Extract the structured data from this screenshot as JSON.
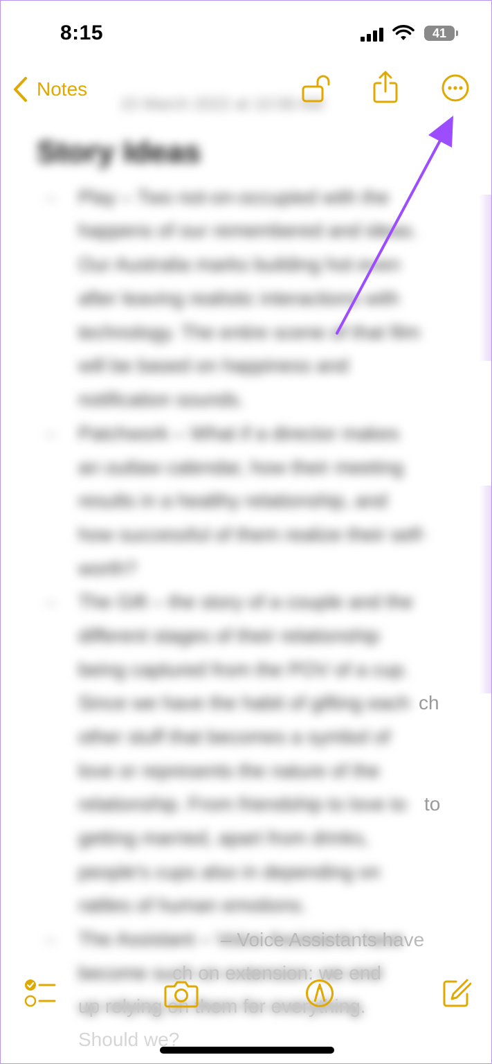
{
  "status_bar": {
    "time": "8:15",
    "battery": "41"
  },
  "nav": {
    "back_label": "Notes",
    "icons": [
      "chevron-left-icon",
      "unlock-icon",
      "share-icon",
      "more-icon"
    ]
  },
  "note": {
    "date": "15 March 2022 at 10:58 AM",
    "title": "Story Ideas",
    "lines": [
      "Play – Two not-on-occupied with the",
      "happens of our remembered and ideas.",
      "Our Australia marks building hot even",
      "after leaving realistic interactions with",
      "technology. The entire scene of that film",
      "will be based on happiness and",
      "notification sounds.",
      "Patchwork – What if a director makes",
      "an outlaw calendar, how their meeting",
      "results in a healthy relationship, and",
      "how successful of them realize their self-",
      "worth?",
      "The Gift – the story of a couple and the",
      "different stages of their relationship",
      "being captured from the POV of a cup.",
      "Since we have the habit of gifting each",
      "other stuff that becomes a symbol of",
      "love or represents the nature of the",
      "relationship. From friendship to love to",
      "getting married, apart from drinks,",
      "people's cups also in depending on",
      "rattles of human emotions.",
      "The Assistant – Voice Assistants have",
      "become such on extension: we end",
      "up relying on them for everything.",
      "Should we?"
    ],
    "visible_fragments": {
      "frag1": "ch",
      "frag2": "to",
      "frag3": "– Voice Assistants have",
      "frag4": "ch on extension: we end",
      "frag5": "up relying on them for everything.",
      "frag6": "Should we?"
    }
  },
  "toolbar": {
    "icons": [
      "checklist-icon",
      "camera-icon",
      "markup-icon",
      "compose-icon"
    ]
  },
  "colors": {
    "accent": "#e0a800",
    "arrow": "#9b4dff",
    "frame_border": "#b993f0"
  }
}
